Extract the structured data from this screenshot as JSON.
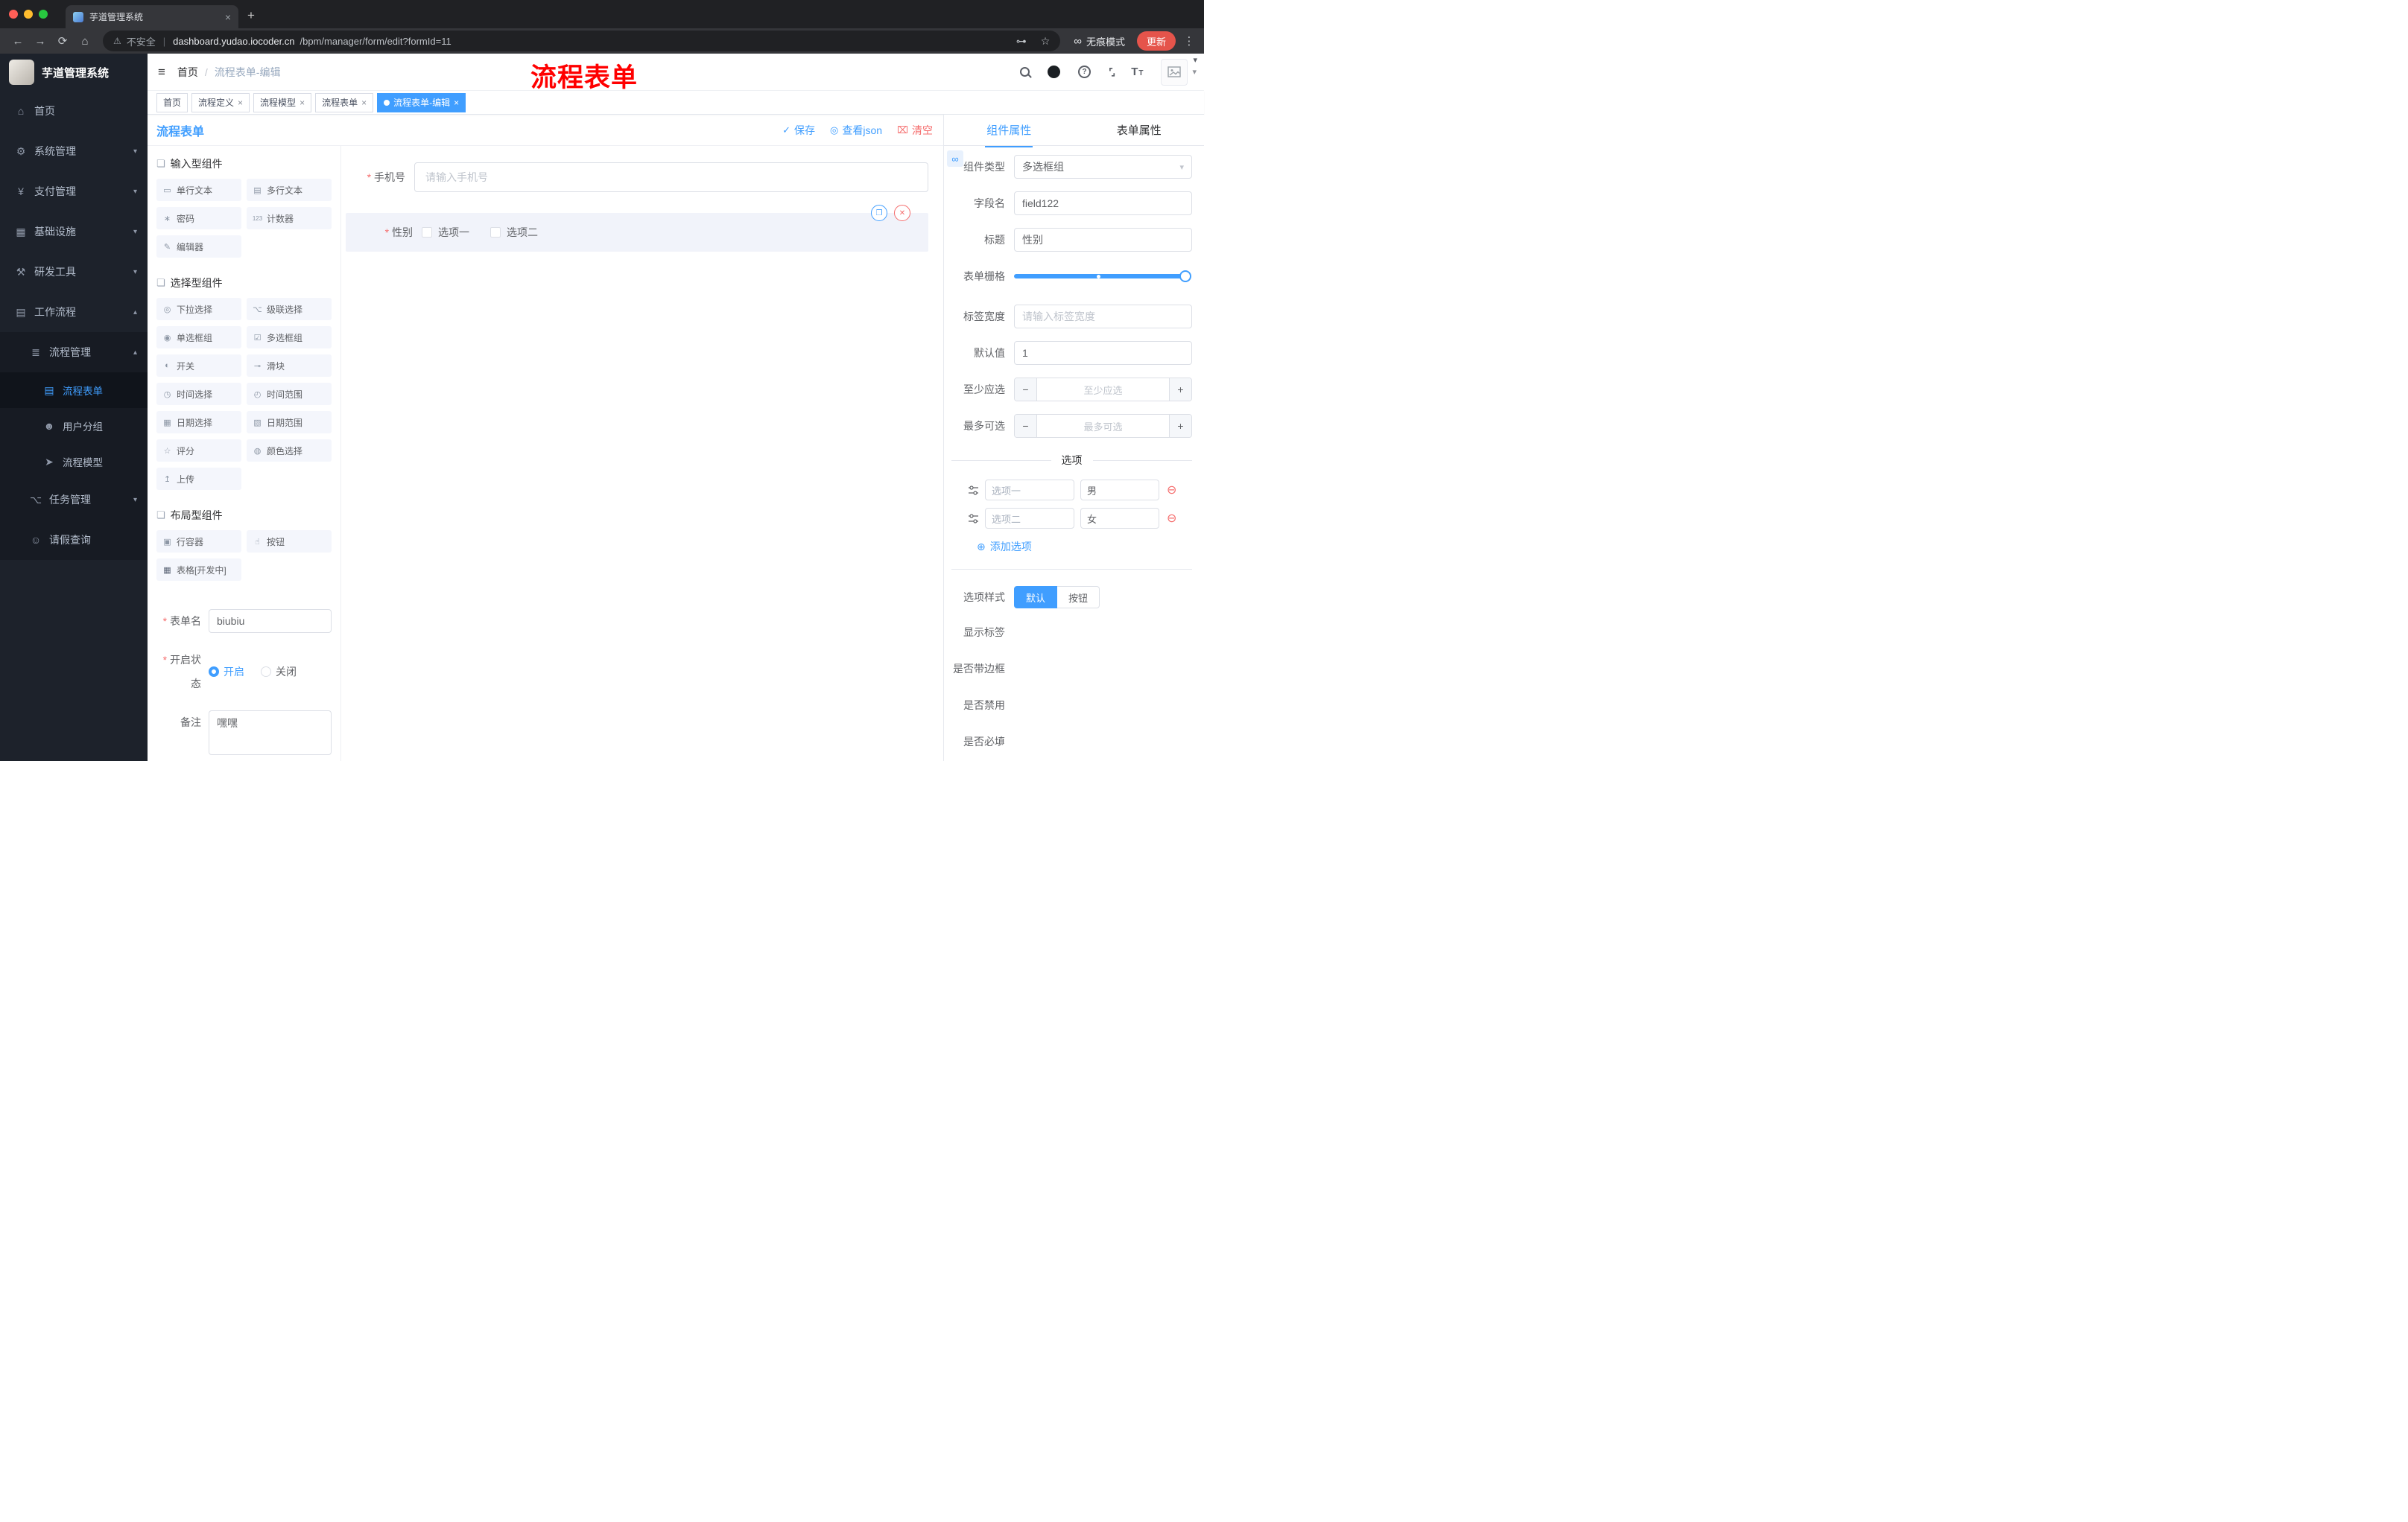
{
  "browser": {
    "tab_title": "芋道管理系统",
    "security_label": "不安全",
    "url_domain": "dashboard.yudao.iocoder.cn",
    "url_path": "/bpm/manager/form/edit?formId=11",
    "incognito_label": "无痕模式",
    "update_label": "更新"
  },
  "icons": {
    "back": "←",
    "forward": "→",
    "reload": "⟳",
    "home": "⌂",
    "warning": "⚠",
    "divider": "|",
    "key": "⊶",
    "star": "☆",
    "incognito": "∞",
    "more": "⋮",
    "close": "×",
    "new_tab": "+",
    "hamburger": "≡",
    "breadcrumb_sep": "/",
    "help": "?",
    "fullscreen": "⌜⌟",
    "font_size_big": "T",
    "font_size_small": "T",
    "caret_down": "▾",
    "chevron_down": "▾",
    "chevron_up": "▴",
    "check": "✓",
    "eye": "◎",
    "trash": "⌧",
    "copy": "❐",
    "delete": "✕",
    "minus_circle": "⊖",
    "plus_circle": "⊕",
    "link": "∞",
    "group_box": "❏",
    "minus": "−",
    "plus": "+",
    "white_dot": ""
  },
  "sidebar": {
    "logo_title": "芋道管理系统",
    "items": [
      {
        "label": "首页",
        "icon": "⌂"
      },
      {
        "label": "系统管理",
        "icon": "⚙"
      },
      {
        "label": "支付管理",
        "icon": "¥"
      },
      {
        "label": "基础设施",
        "icon": "▦"
      },
      {
        "label": "研发工具",
        "icon": "⚒"
      },
      {
        "label": "工作流程",
        "icon": "▤"
      },
      {
        "label": "流程管理",
        "icon": "≣"
      },
      {
        "label": "流程表单",
        "icon": "▤"
      },
      {
        "label": "用户分组",
        "icon": "☻"
      },
      {
        "label": "流程模型",
        "icon": "➤"
      },
      {
        "label": "任务管理",
        "icon": "⌥"
      },
      {
        "label": "请假查询",
        "icon": "☺"
      }
    ]
  },
  "header": {
    "breadcrumb_home": "首页",
    "breadcrumb_current": "流程表单-编辑",
    "annotation": "流程表单"
  },
  "tags": [
    {
      "label": "首页"
    },
    {
      "label": "流程定义"
    },
    {
      "label": "流程模型"
    },
    {
      "label": "流程表单"
    },
    {
      "label": "流程表单-编辑"
    }
  ],
  "builder": {
    "panel_title": "流程表单",
    "save": "保存",
    "view_json": "查看json",
    "clear": "清空",
    "groups": [
      {
        "title": "输入型组件",
        "items": [
          {
            "label": "单行文本",
            "icon": "▭"
          },
          {
            "label": "多行文本",
            "icon": "▤"
          },
          {
            "label": "密码",
            "icon": "∗"
          },
          {
            "label": "计数器",
            "icon": "123"
          },
          {
            "label": "编辑器",
            "icon": "✎"
          }
        ]
      },
      {
        "title": "选择型组件",
        "items": [
          {
            "label": "下拉选择",
            "icon": "◎"
          },
          {
            "label": "级联选择",
            "icon": "⌥"
          },
          {
            "label": "单选框组",
            "icon": "◉"
          },
          {
            "label": "多选框组",
            "icon": "☑"
          },
          {
            "label": "开关",
            "icon": "◐"
          },
          {
            "label": "滑块",
            "icon": "⊸"
          },
          {
            "label": "时间选择",
            "icon": "◷"
          },
          {
            "label": "时间范围",
            "icon": "◴"
          },
          {
            "label": "日期选择",
            "icon": "▦"
          },
          {
            "label": "日期范围",
            "icon": "▧"
          },
          {
            "label": "评分",
            "icon": "☆"
          },
          {
            "label": "颜色选择",
            "icon": "◍"
          },
          {
            "label": "上传",
            "icon": "↥"
          }
        ]
      },
      {
        "title": "布局型组件",
        "items": [
          {
            "label": "行容器",
            "icon": "▣"
          },
          {
            "label": "按钮",
            "icon": "☝"
          },
          {
            "label": "表格[开发中]",
            "icon": "▦"
          }
        ]
      }
    ],
    "meta": {
      "name_label": "表单名",
      "name_value": "biubiu",
      "status_label": "开启状态",
      "status_on": "开启",
      "status_off": "关闭",
      "remark_label": "备注",
      "remark_value": "嘿嘿"
    },
    "canvas": {
      "phone_label": "手机号",
      "phone_placeholder": "请输入手机号",
      "gender_label": "性别",
      "option1": "选项一",
      "option2": "选项二"
    }
  },
  "props": {
    "tab_component": "组件属性",
    "tab_form": "表单属性",
    "component_type_label": "组件类型",
    "component_type_value": "多选框组",
    "field_label": "字段名",
    "field_value": "field122",
    "title_label": "标题",
    "title_value": "性别",
    "grid_label": "表单栅格",
    "width_label": "标签宽度",
    "width_placeholder": "请输入标签宽度",
    "default_label": "默认值",
    "default_value": "1",
    "min_label": "至少应选",
    "min_placeholder": "至少应选",
    "max_label": "最多可选",
    "max_placeholder": "最多可选",
    "options_title": "选项",
    "option_rows": [
      {
        "name": "选项一",
        "value": "男"
      },
      {
        "name": "选项二",
        "value": "女"
      }
    ],
    "add_option": "添加选项",
    "style_label": "选项样式",
    "style_default": "默认",
    "style_button": "按钮",
    "toggle_rows": [
      {
        "label": "显示标签",
        "on": true
      },
      {
        "label": "是否带边框",
        "on": false
      },
      {
        "label": "是否禁用",
        "on": false
      },
      {
        "label": "是否必填",
        "on": true
      }
    ]
  },
  "colors": {
    "accent": "#409eff",
    "danger": "#f56c6c",
    "annotation": "#ff0000",
    "sidebar_bg": "#1d222b"
  }
}
